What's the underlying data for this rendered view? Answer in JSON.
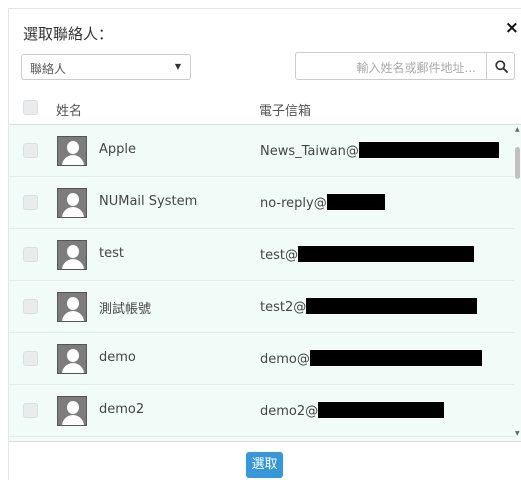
{
  "dialog": {
    "title": "選取聯絡人：",
    "close_label": "×"
  },
  "filter": {
    "select_value": "聯絡人",
    "search_placeholder": "輸入姓名或郵件地址...",
    "search_icon": "search-icon"
  },
  "table": {
    "headers": {
      "name": "姓名",
      "email": "電子信箱"
    },
    "rows": [
      {
        "name": "Apple",
        "email_prefix": "News_Taiwan@"
      },
      {
        "name": "NUMail System",
        "email_prefix": "no-reply@"
      },
      {
        "name": "test",
        "email_prefix": "test@"
      },
      {
        "name": "測試帳號",
        "email_prefix": "test2@"
      },
      {
        "name": "demo",
        "email_prefix": "demo@"
      },
      {
        "name": "demo2",
        "email_prefix": "demo2@"
      }
    ]
  },
  "footer": {
    "select_label": "選取"
  },
  "colors": {
    "accent": "#3498db",
    "row_background": "#f1fcf8"
  }
}
